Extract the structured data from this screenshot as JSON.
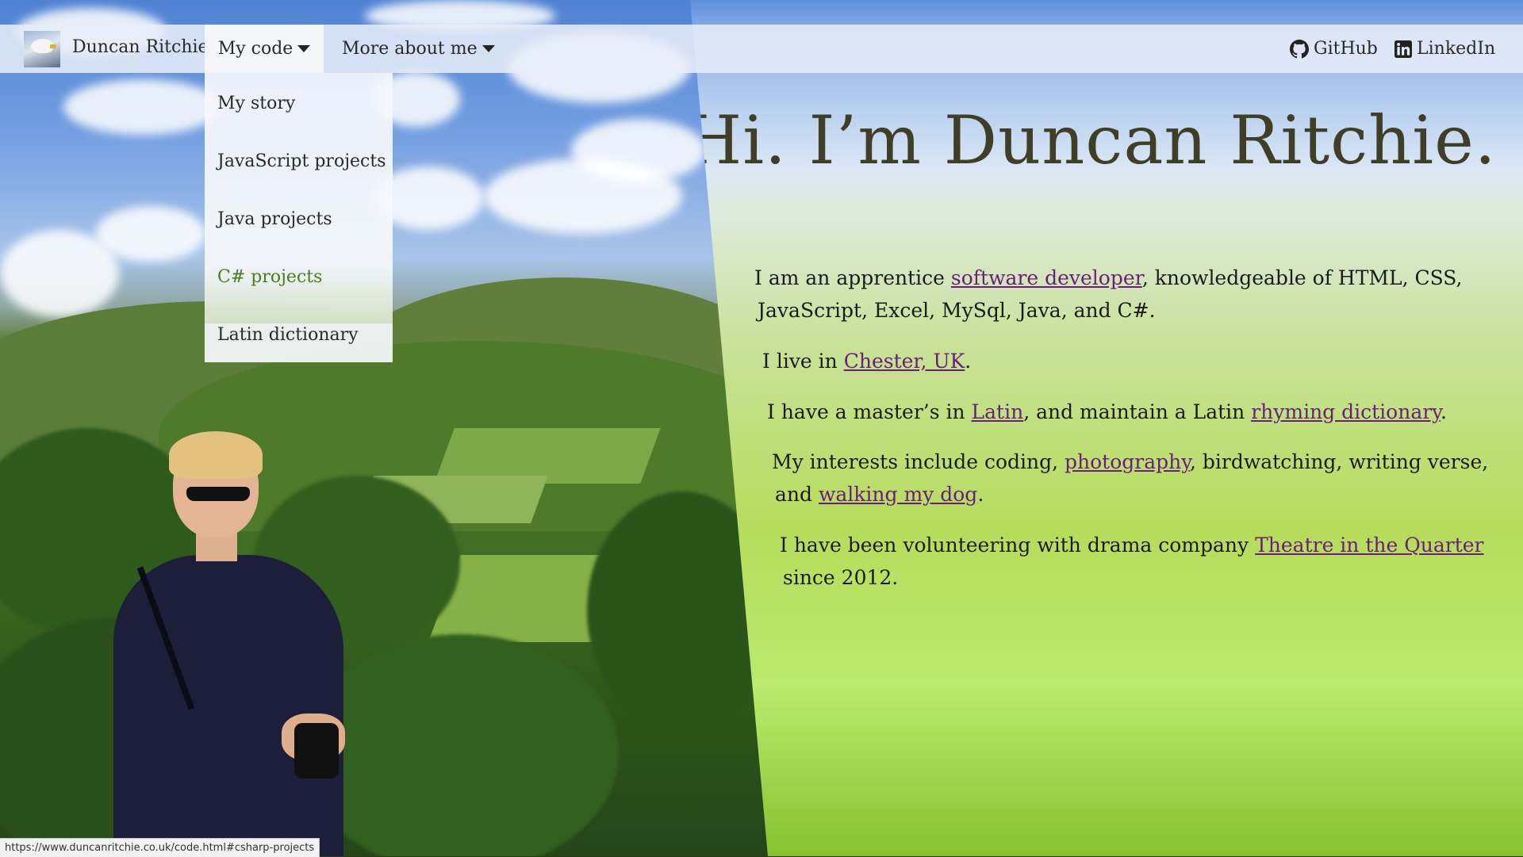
{
  "nav": {
    "brand": "Duncan Ritchie",
    "my_code": "My code",
    "more_about_me": "More about me",
    "github": "GitHub",
    "linkedin": "LinkedIn"
  },
  "dropdown": {
    "items": [
      "My story",
      "JavaScript projects",
      "Java projects",
      "C# projects",
      "Latin dictionary"
    ],
    "hovered": "C# projects"
  },
  "hero": {
    "title": "Hi. I’m Duncan Ritchie."
  },
  "bio": {
    "p1_a": "I am an apprentice ",
    "p1_link": "software developer",
    "p1_b": ", knowledgeable of HTML, CSS,",
    "p1_c": "JavaScript, Excel, MySql, Java, and C#.",
    "p2_a": "I live in ",
    "p2_link": "Chester, UK",
    "p2_b": ".",
    "p3_a": "I have a master’s in ",
    "p3_link1": "Latin",
    "p3_b": ", and maintain a Latin ",
    "p3_link2": "rhyming dictionary",
    "p3_c": ".",
    "p4_a": "My interests include coding, ",
    "p4_link1": "photography",
    "p4_b": ", birdwatching, writing verse,",
    "p4_c": "and ",
    "p4_link2": "walking my dog",
    "p4_d": ".",
    "p5_a": "I have been volunteering with drama company ",
    "p5_link": "Theatre in the Quarter",
    "p5_b": "since 2012."
  },
  "status_url": "https://www.duncanritchie.co.uk/code.html#csharp-projects",
  "colors": {
    "link": "#6a1e7a",
    "dropdown_hover": "#4d7a25",
    "title": "#3f3f28"
  },
  "icons": {
    "brand": "seagull-logo",
    "github": "github-icon",
    "linkedin": "linkedin-icon"
  }
}
